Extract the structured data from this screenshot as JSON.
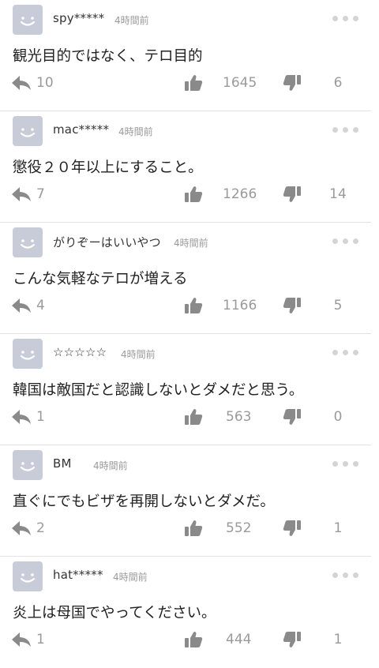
{
  "colors": {
    "icon": "#8a8a8a",
    "avatar_bg": "#c8cbd8",
    "divider": "#e3e3e3"
  },
  "icons": {
    "avatar": "smiley-avatar-icon",
    "more": "more-dots-icon",
    "reply": "reply-arrow-icon",
    "like": "thumbs-up-icon",
    "dislike": "thumbs-down-icon"
  },
  "comments": [
    {
      "name": "spy*****",
      "time": "4時間前",
      "text": "観光目的ではなく、テロ目的",
      "replies": "10",
      "likes": "1645",
      "dislikes": "6"
    },
    {
      "name": "mac*****",
      "time": "4時間前",
      "text": "懲役２０年以上にすること。",
      "replies": "7",
      "likes": "1266",
      "dislikes": "14"
    },
    {
      "name": "がりぞーはいいやつ",
      "time": "4時間前",
      "text": "こんな気軽なテロが増える",
      "replies": "4",
      "likes": "1166",
      "dislikes": "5"
    },
    {
      "name": "☆☆☆☆☆",
      "time": "4時間前",
      "text": "韓国は敵国だと認識しないとダメだと思う。",
      "replies": "1",
      "likes": "563",
      "dislikes": "0"
    },
    {
      "name": "BM",
      "time": "4時間前",
      "text": "直ぐにでもビザを再開しないとダメだ。",
      "replies": "2",
      "likes": "552",
      "dislikes": "1"
    },
    {
      "name": "hat*****",
      "time": "4時間前",
      "text": "炎上は母国でやってください。",
      "replies": "1",
      "likes": "444",
      "dislikes": "1"
    }
  ]
}
